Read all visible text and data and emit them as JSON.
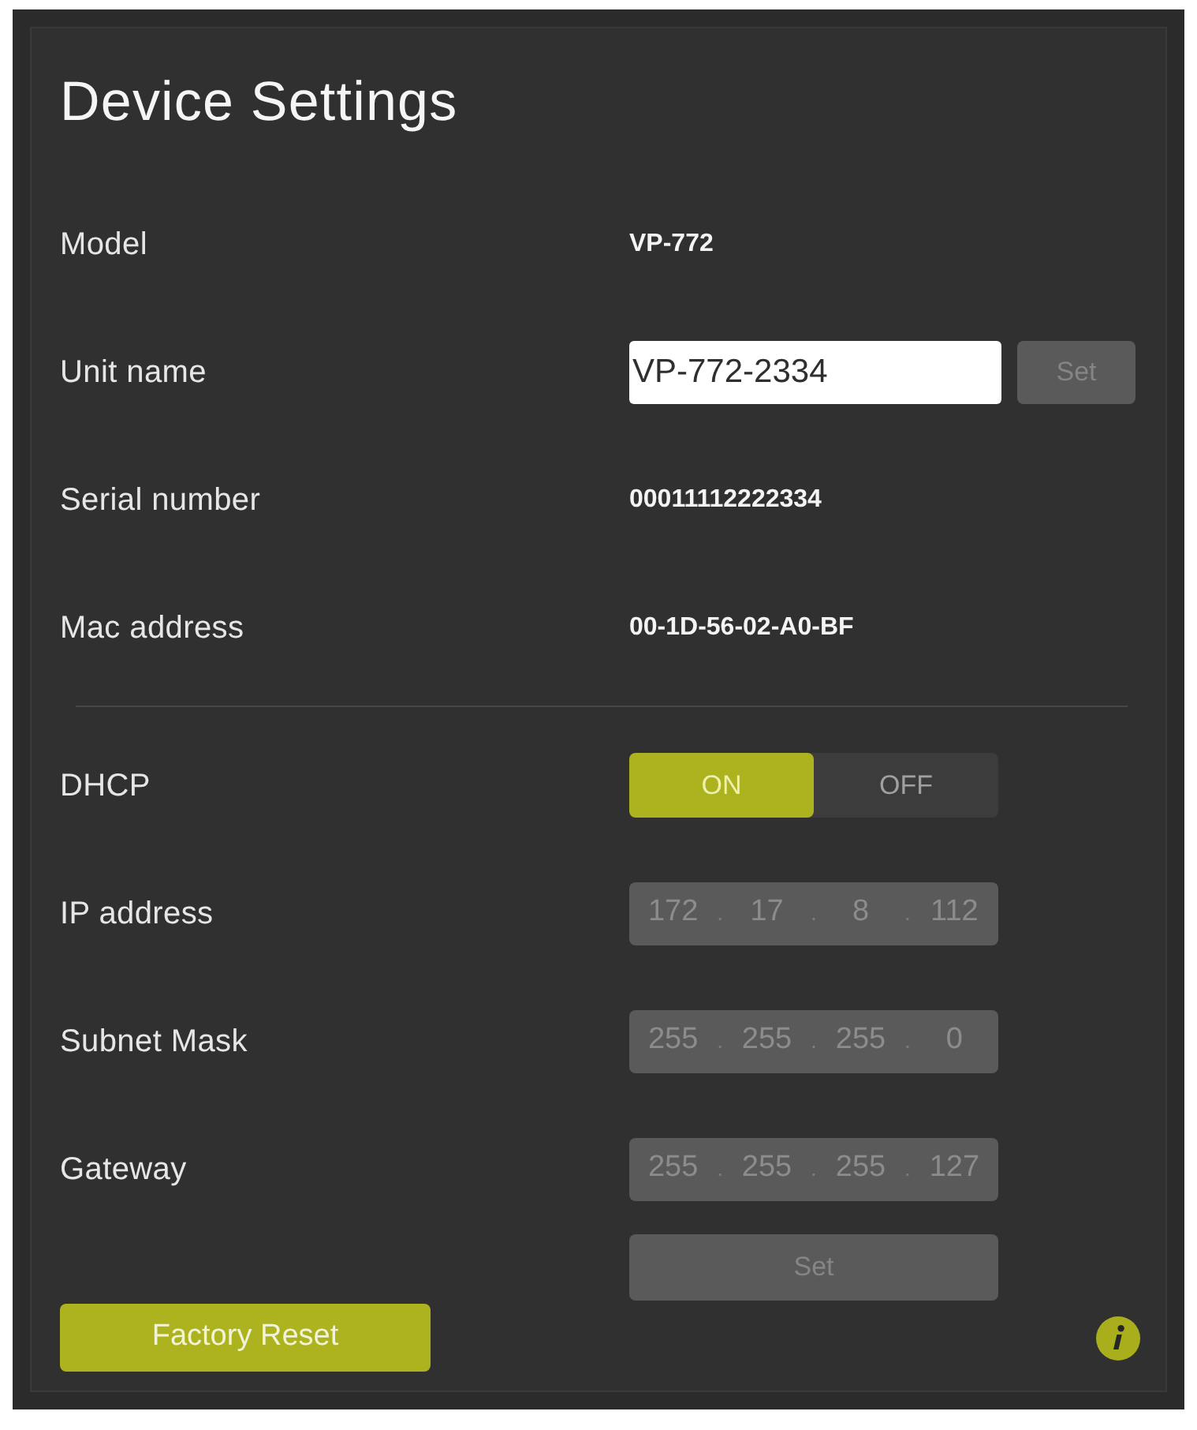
{
  "title": "Device Settings",
  "rows": [
    {
      "kind": "text",
      "label": "Model",
      "value": "VP-772"
    },
    {
      "kind": "input",
      "label": "Unit name",
      "value": "VP-772-2334",
      "button": {
        "label": "Set",
        "disabled": true
      }
    },
    {
      "kind": "text",
      "label": "Serial number",
      "value": "00011112222334"
    },
    {
      "kind": "text",
      "label": "Mac address",
      "value": "00-1D-56-02-A0-BF"
    }
  ],
  "network": {
    "dhcp": {
      "label": "DHCP",
      "options": [
        {
          "label": "ON",
          "selected": true
        },
        {
          "label": "OFF",
          "selected": false
        }
      ]
    },
    "fields": [
      {
        "label": "IP address",
        "disabled": true,
        "separator": ".",
        "octets": [
          "172",
          "17",
          "8",
          "112"
        ]
      },
      {
        "label": "Subnet Mask",
        "disabled": true,
        "separator": ".",
        "octets": [
          "255",
          "255",
          "255",
          "0"
        ]
      },
      {
        "label": "Gateway",
        "disabled": true,
        "separator": ".",
        "octets": [
          "255",
          "255",
          "255",
          "127"
        ]
      }
    ],
    "set_button": {
      "label": "Set",
      "disabled": true
    }
  },
  "factory_reset": {
    "label": "Factory Reset"
  }
}
